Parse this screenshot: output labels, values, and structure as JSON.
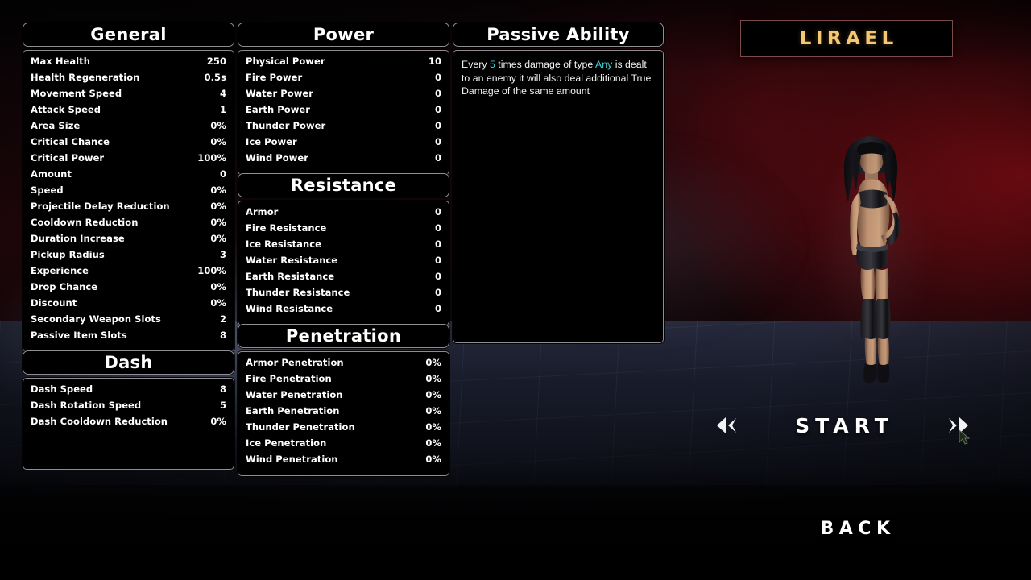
{
  "character": {
    "name": "LIRAEL"
  },
  "panels": {
    "general": {
      "title": "General",
      "rows": [
        {
          "label": "Max Health",
          "value": "250"
        },
        {
          "label": "Health Regeneration",
          "value": "0.5s"
        },
        {
          "label": "Movement Speed",
          "value": "4"
        },
        {
          "label": "Attack Speed",
          "value": "1"
        },
        {
          "label": "Area Size",
          "value": "0%"
        },
        {
          "label": "Critical Chance",
          "value": "0%"
        },
        {
          "label": "Critical Power",
          "value": "100%"
        },
        {
          "label": "Amount",
          "value": "0"
        },
        {
          "label": "Speed",
          "value": "0%"
        },
        {
          "label": "Projectile Delay Reduction",
          "value": "0%"
        },
        {
          "label": "Cooldown Reduction",
          "value": "0%"
        },
        {
          "label": "Duration Increase",
          "value": "0%"
        },
        {
          "label": "Pickup Radius",
          "value": "3"
        },
        {
          "label": "Experience",
          "value": "100%"
        },
        {
          "label": "Drop Chance",
          "value": "0%"
        },
        {
          "label": "Discount",
          "value": "0%"
        },
        {
          "label": "Secondary Weapon Slots",
          "value": "2"
        },
        {
          "label": "Passive Item Slots",
          "value": "8"
        }
      ]
    },
    "dash": {
      "title": "Dash",
      "rows": [
        {
          "label": "Dash Speed",
          "value": "8"
        },
        {
          "label": "Dash Rotation Speed",
          "value": "5"
        },
        {
          "label": "Dash Cooldown Reduction",
          "value": "0%"
        }
      ]
    },
    "power": {
      "title": "Power",
      "rows": [
        {
          "label": "Physical Power",
          "value": "10"
        },
        {
          "label": "Fire Power",
          "value": "0"
        },
        {
          "label": "Water Power",
          "value": "0"
        },
        {
          "label": "Earth Power",
          "value": "0"
        },
        {
          "label": "Thunder Power",
          "value": "0"
        },
        {
          "label": "Ice Power",
          "value": "0"
        },
        {
          "label": "Wind Power",
          "value": "0"
        }
      ]
    },
    "resistance": {
      "title": "Resistance",
      "rows": [
        {
          "label": "Armor",
          "value": "0"
        },
        {
          "label": "Fire Resistance",
          "value": "0"
        },
        {
          "label": "Ice Resistance",
          "value": "0"
        },
        {
          "label": "Water Resistance",
          "value": "0"
        },
        {
          "label": "Earth Resistance",
          "value": "0"
        },
        {
          "label": "Thunder Resistance",
          "value": "0"
        },
        {
          "label": "Wind Resistance",
          "value": "0"
        }
      ]
    },
    "penetration": {
      "title": "Penetration",
      "rows": [
        {
          "label": "Armor Penetration",
          "value": "0%"
        },
        {
          "label": "Fire Penetration",
          "value": "0%"
        },
        {
          "label": "Water Penetration",
          "value": "0%"
        },
        {
          "label": "Earth Penetration",
          "value": "0%"
        },
        {
          "label": "Thunder Penetration",
          "value": "0%"
        },
        {
          "label": "Ice Penetration",
          "value": "0%"
        },
        {
          "label": "Wind Penetration",
          "value": "0%"
        }
      ]
    },
    "passive_ability": {
      "title": "Passive Ability",
      "description_parts": [
        {
          "text": "Every ",
          "highlight": false
        },
        {
          "text": "5",
          "highlight": true
        },
        {
          "text": " times damage of type ",
          "highlight": false
        },
        {
          "text": "Any",
          "highlight": true
        },
        {
          "text": " is dealt to an enemy it will also deal additional True Damage of the same amount",
          "highlight": false
        }
      ]
    }
  },
  "footer": {
    "start_label": "START",
    "back_label": "BACK",
    "prev_icon": "chevron-left-icon",
    "next_icon": "chevron-right-icon"
  },
  "colors": {
    "highlight": "#3fd0d8",
    "name_gold": "#f2c877",
    "panel_border": "#8e8e92",
    "nameplate_border": "#7c4a4a"
  }
}
